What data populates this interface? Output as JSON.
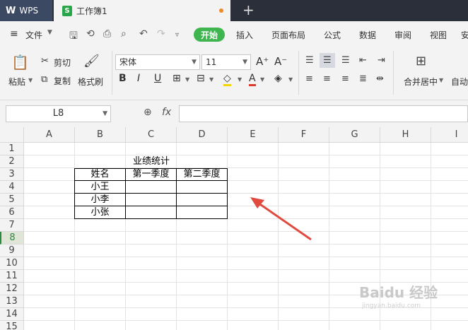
{
  "app": {
    "name": "WPS",
    "doc_tab": "工作簿1",
    "doc_icon": "S"
  },
  "menu": {
    "file": "文件",
    "start": "开始",
    "items": [
      "插入",
      "页面布局",
      "公式",
      "数据",
      "审阅",
      "视图",
      "安"
    ]
  },
  "ribbon": {
    "paste": "粘贴",
    "cut": "剪切",
    "copy": "复制",
    "format_painter": "格式刷",
    "font_name": "宋体",
    "font_size": "11",
    "merge": "合并居中",
    "auto": "自动"
  },
  "formula_bar": {
    "cell_ref": "L8",
    "fx": "fx",
    "value": ""
  },
  "grid": {
    "columns": [
      "A",
      "B",
      "C",
      "D",
      "E",
      "F",
      "G",
      "H",
      "I"
    ],
    "rows": [
      "1",
      "2",
      "3",
      "4",
      "5",
      "6",
      "7",
      "8",
      "9",
      "10",
      "11",
      "12",
      "13",
      "14",
      "15"
    ],
    "selected_row": "8",
    "table_title": "业绩统计",
    "headers": [
      "姓名",
      "第一季度",
      "第二季度"
    ],
    "names": [
      "小王",
      "小李",
      "小张"
    ]
  },
  "watermark": {
    "text": "Baidu 经验",
    "sub": "jingyan.baidu.com"
  },
  "colors": {
    "accent": "#3eb54e",
    "titlebar": "#2b2f3a",
    "arrow": "#e04a3f"
  }
}
